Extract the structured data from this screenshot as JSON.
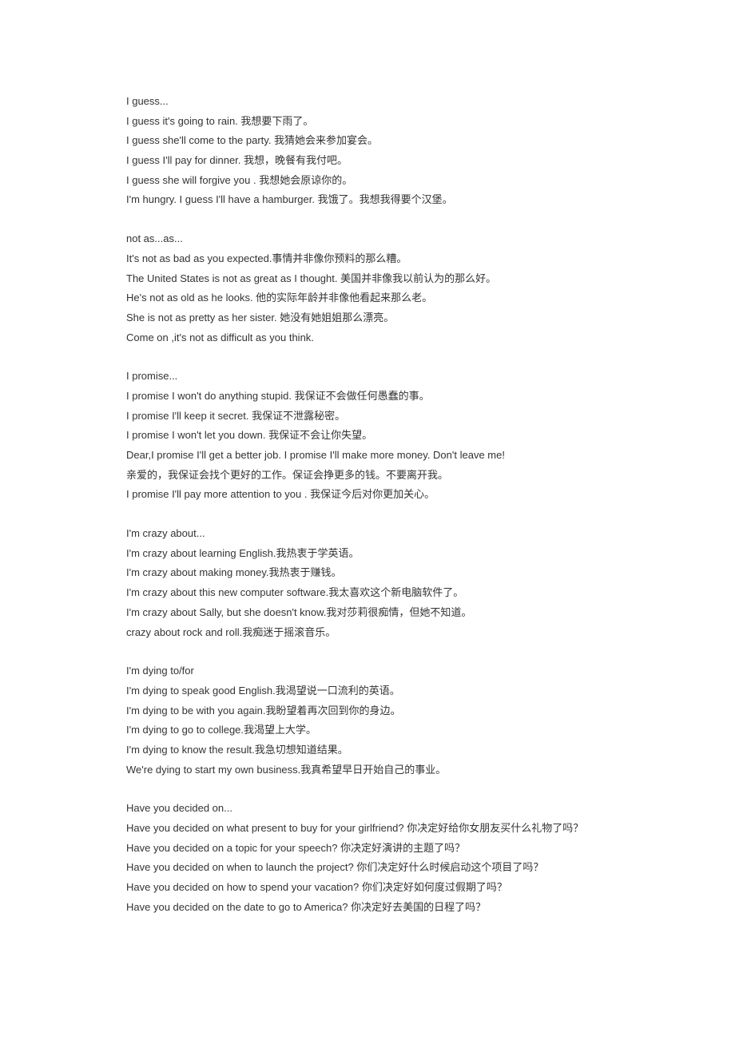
{
  "sections": [
    {
      "header": "I guess...",
      "lines": [
        "I guess it's going to rain.  我想要下雨了。",
        "I guess she'll come to the party.  我猜她会来参加宴会。",
        "I guess I'll pay for dinner.  我想，晚餐有我付吧。",
        "I guess she will forgive you .  我想她会原谅你的。",
        "I'm hungry. I guess I'll have a hamburger.  我饿了。我想我得要个汉堡。"
      ]
    },
    {
      "header": "not as...as...",
      "lines": [
        "It's not as bad as you expected.事情并非像你预料的那么糟。",
        "The United States is not as great as I thought.  美国并非像我以前认为的那么好。",
        "He's not as old as he looks.  他的实际年龄并非像他看起来那么老。",
        "She is not as pretty as her sister.  她没有她姐姐那么漂亮。",
        "Come on ,it's not as difficult as you think."
      ]
    },
    {
      "header": "I promise...",
      "lines": [
        "I promise I won't do anything stupid.  我保证不会做任何愚蠢的事。",
        "I promise I'll keep it secret.  我保证不泄露秘密。",
        "I promise I won't let you down.  我保证不会让你失望。",
        "Dear,I promise I'll get a better job. I promise I'll make more money. Don't leave me!",
        "亲爱的，我保证会找个更好的工作。保证会挣更多的钱。不要离开我。",
        "I promise I'll pay more attention to you .  我保证今后对你更加关心。"
      ]
    },
    {
      "header": "I'm crazy about...",
      "lines": [
        "I'm crazy about learning English.我热衷于学英语。",
        "I'm crazy about making money.我热衷于赚钱。",
        "I'm crazy about this new computer software.我太喜欢这个新电脑软件了。",
        "I'm crazy about Sally, but she doesn't know.我对莎莉很痴情，但她不知道。",
        "crazy about rock and roll.我痴迷于摇滚音乐。"
      ]
    },
    {
      "header": "I'm dying to/for",
      "lines": [
        "I'm dying to speak good English.我渴望说一口流利的英语。",
        "I'm dying to be with you again.我盼望着再次回到你的身边。",
        "I'm dying to go to college.我渴望上大学。",
        "I'm dying to know the result.我急切想知道结果。",
        "We're dying to start my own business.我真希望早日开始自己的事业。"
      ]
    },
    {
      "header": "Have you decided on...",
      "lines": [
        "Have you decided on what present to buy for your girlfriend?  你决定好给你女朋友买什么礼物了吗？",
        "Have you decided on a topic for your speech?  你决定好演讲的主题了吗？",
        "Have you decided on when to launch the project?  你们决定好什么时候启动这个项目了吗？",
        "Have you decided on how to spend your vacation?  你们决定好如何度过假期了吗？",
        "Have you decided on the date to go to America?  你决定好去美国的日程了吗？"
      ]
    }
  ]
}
